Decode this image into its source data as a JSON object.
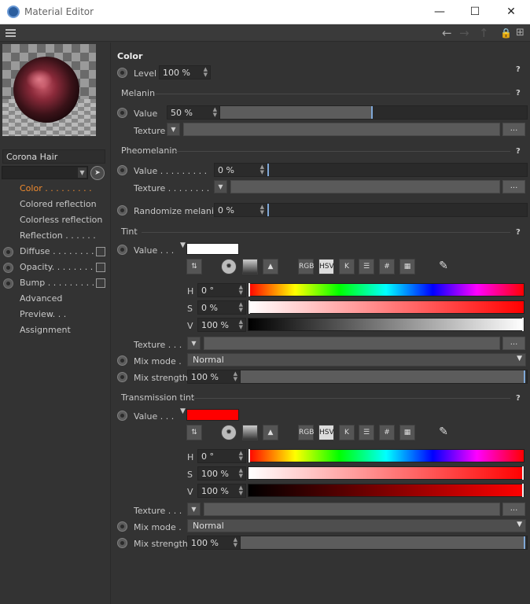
{
  "window": {
    "title": "Material Editor"
  },
  "material": {
    "name": "Corona Hair"
  },
  "nav": [
    {
      "label": "Color . . . . . . . . ."
    },
    {
      "label": "Colored reflection"
    },
    {
      "label": "Colorless reflection"
    },
    {
      "label": "Reflection . . . . . ."
    },
    {
      "label": "Diffuse . . . . . . . ."
    },
    {
      "label": "Opacity. . . . . . . ."
    },
    {
      "label": "Bump . . . . . . . . ."
    },
    {
      "label": "Advanced"
    },
    {
      "label": "Preview. . ."
    },
    {
      "label": "Assignment"
    }
  ],
  "panel": {
    "title": "Color",
    "help": "?",
    "level": {
      "label": "Level",
      "value": "100 %"
    },
    "melanin": {
      "header": "Melanin",
      "value_label": "Value",
      "value": "50 %",
      "fraction": 0.5,
      "texture_label": "Texture",
      "more": "..."
    },
    "pheomelanin": {
      "header": "Pheomelanin",
      "value_label": "Value . . . . . . . . .",
      "value": "0 %",
      "fraction": 0.0,
      "texture_label": "Texture . . . . . . . .",
      "more": "..."
    },
    "randomize": {
      "label": "Randomize melanin",
      "value": "0 %",
      "fraction": 0.0
    },
    "tint": {
      "header": "Tint",
      "value_label": "Value . . .",
      "swatch_color": "#ffffff",
      "h_label": "H",
      "h": "0 °",
      "s_label": "S",
      "s": "0 %",
      "v_label": "V",
      "v": "100 %",
      "texture_label": "Texture . . .",
      "more": "...",
      "mix_mode_label": "Mix mode .",
      "mix_mode": "Normal",
      "mix_strength_label": "Mix strength",
      "mix_strength": "100 %",
      "mix_fraction": 1.0
    },
    "transmission": {
      "header": "Transmission tint",
      "value_label": "Value . . .",
      "swatch_color": "#ff0000",
      "h_label": "H",
      "h": "0 °",
      "s_label": "S",
      "s": "100 %",
      "v_label": "V",
      "v": "100 %",
      "texture_label": "Texture . . .",
      "more": "...",
      "mix_mode_label": "Mix mode .",
      "mix_mode": "Normal",
      "mix_strength_label": "Mix strength",
      "mix_strength": "100 %",
      "mix_fraction": 1.0
    },
    "color_tools": [
      "RGB",
      "HSV",
      "K",
      "#"
    ]
  }
}
